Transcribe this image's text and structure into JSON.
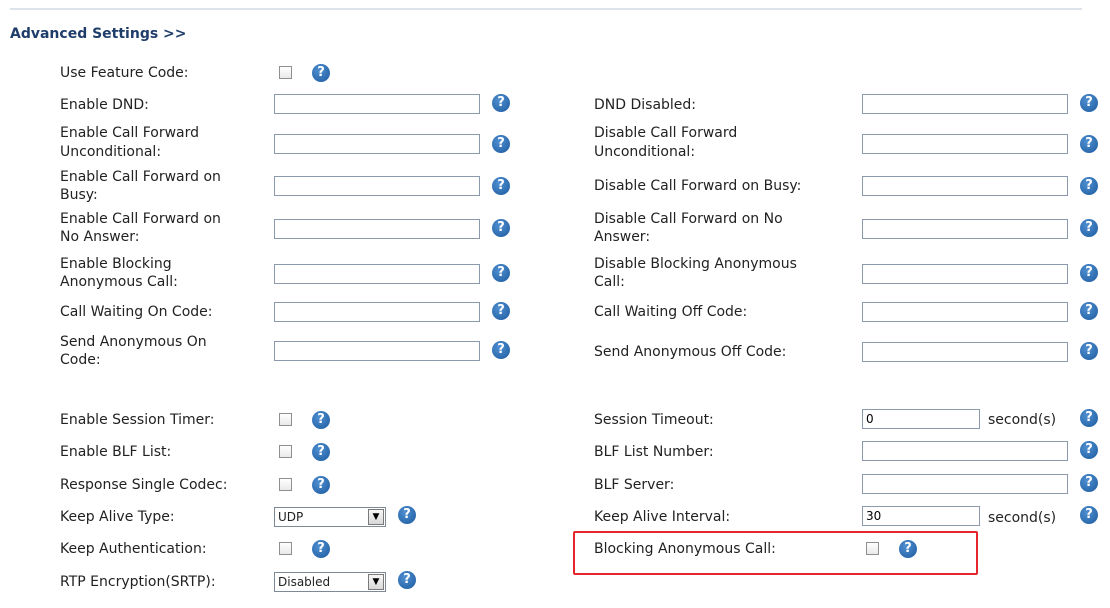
{
  "section_title": "Advanced Settings >>",
  "help_glyph": "?",
  "select_arrow_glyph": "▼",
  "colors": {
    "highlight_border": "#e5272d",
    "help_icon": "#2a6cb5",
    "section_title": "#1f3d6b"
  },
  "labels": {
    "use_feature_code": "Use Feature Code:",
    "enable_dnd": "Enable DND:",
    "dnd_disabled": "DND Disabled:",
    "enable_cfu_1": "Enable Call Forward",
    "enable_cfu_2": "Unconditional:",
    "disable_cfu_1": "Disable Call Forward",
    "disable_cfu_2": "Unconditional:",
    "enable_cfb_1": "Enable Call Forward on",
    "enable_cfb_2": "Busy:",
    "disable_cfb": "Disable Call Forward on Busy:",
    "enable_cfna_1": "Enable Call Forward on",
    "enable_cfna_2": "No Answer:",
    "disable_cfna_1": "Disable Call Forward on No",
    "disable_cfna_2": "Answer:",
    "enable_block_1": "Enable Blocking",
    "enable_block_2": "Anonymous Call:",
    "disable_block_1": "Disable Blocking Anonymous",
    "disable_block_2": "Call:",
    "cw_on": "Call Waiting On Code:",
    "cw_off": "Call Waiting Off Code:",
    "send_anon_on_1": "Send Anonymous On",
    "send_anon_on_2": "Code:",
    "send_anon_off": "Send Anonymous Off Code:",
    "enable_session_timer": "Enable Session Timer:",
    "session_timeout": "Session Timeout:",
    "seconds_1": "second(s)",
    "enable_blf_list": "Enable BLF List:",
    "blf_list_number": "BLF List Number:",
    "response_single_codec": "Response Single Codec:",
    "blf_server": "BLF Server:",
    "keep_alive_type": "Keep Alive Type:",
    "keep_alive_interval": "Keep Alive Interval:",
    "seconds_2": "second(s)",
    "keep_authentication": "Keep Authentication:",
    "blocking_anonymous_call": "Blocking Anonymous Call:",
    "rtp_encryption": "RTP Encryption(SRTP):"
  },
  "values": {
    "enable_dnd": "",
    "dnd_disabled": "",
    "enable_cfu": "",
    "disable_cfu": "",
    "enable_cfb": "",
    "disable_cfb": "",
    "enable_cfna": "",
    "disable_cfna": "",
    "enable_block": "",
    "disable_block": "",
    "cw_on": "",
    "cw_off": "",
    "send_anon_on": "",
    "send_anon_off": "",
    "session_timeout": "0",
    "blf_list_number": "",
    "blf_server": "",
    "keep_alive_type": "UDP",
    "keep_alive_interval": "30",
    "rtp_encryption": "Disabled"
  }
}
